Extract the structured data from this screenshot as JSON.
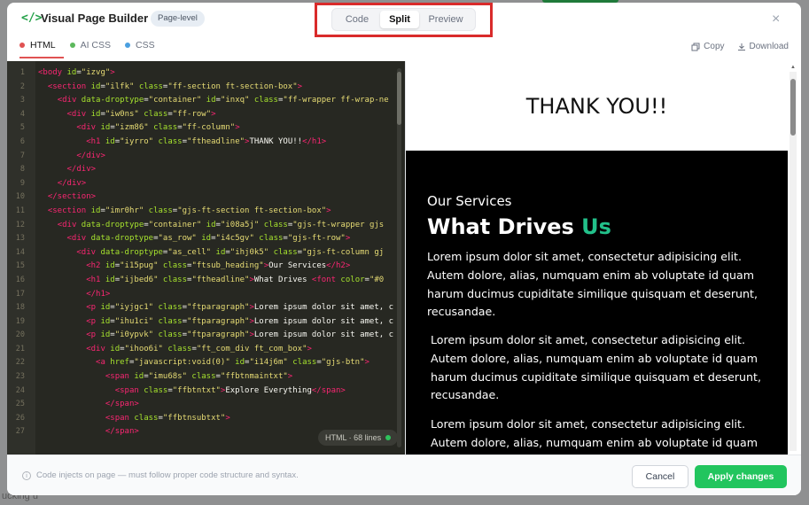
{
  "header": {
    "brand_icon": "</>",
    "title": "Visual Page Builder",
    "badge": "Page-level",
    "view_modes": [
      "Code",
      "Split",
      "Preview"
    ],
    "active_view": "Split",
    "close_icon": "×"
  },
  "file_tabs": [
    {
      "label": "HTML",
      "color": "#e05252",
      "active": true
    },
    {
      "label": "AI CSS",
      "color": "#5cb85c",
      "active": false
    },
    {
      "label": "CSS",
      "color": "#4a9fe0",
      "active": false
    }
  ],
  "actions": {
    "copy": "Copy",
    "download": "Download"
  },
  "editor": {
    "status": "HTML · 68 lines",
    "lines": [
      "<body id=\"izvg\">",
      "  <section id=\"ilfk\" class=\"ff-section ft-section-box\">",
      "    <div data-droptype=\"container\" id=\"inxq\" class=\"ff-wrapper ff-wrap-ne",
      "      <div id=\"iw0ns\" class=\"ff-row\">",
      "        <div id=\"izm86\" class=\"ff-column\">",
      "          <h1 id=\"iyrro\" class=\"ftheadline\">THANK YOU!!</h1>",
      "        </div>",
      "      </div>",
      "    </div>",
      "  </section>",
      "  <section id=\"imr0hr\" class=\"gjs-ft-section ft-section-box\">",
      "    <div data-droptype=\"container\" id=\"i08a5j\" class=\"gjs-ft-wrapper gjs",
      "      <div data-droptype=\"as_row\" id=\"i4c5gv\" class=\"gjs-ft-row\">",
      "        <div data-droptype=\"as_cell\" id=\"ihj0k5\" class=\"gjs-ft-column gj",
      "          <h2 id=\"i15pug\" class=\"ftsub_heading\">Our Services</h2>",
      "          <h1 id=\"ijbed6\" class=\"ftheadline\">What Drives <font color=\"#0",
      "          </h1>",
      "          <p id=\"iyjgc1\" class=\"ftparagraph\">Lorem ipsum dolor sit amet, c",
      "          <p id=\"ihu1ci\" class=\"ftparagraph\">Lorem ipsum dolor sit amet, c",
      "          <p id=\"i0ypvk\" class=\"ftparagraph\">Lorem ipsum dolor sit amet, c",
      "          <div id=\"ihoo6i\" class=\"ft_com_div ft_com_box\">",
      "            <a href=\"javascript:void(0)\" id=\"i14j6m\" class=\"gjs-btn\">",
      "              <span id=\"imu68s\" class=\"ffbtnmaintxt\">",
      "                <span class=\"ffbtntxt\">Explore Everything</span>",
      "              </span>",
      "              <span class=\"ffbtnsubtxt\">",
      "              </span>"
    ]
  },
  "preview": {
    "thanks": "THANK YOU!!",
    "subheading": "Our Services",
    "headline_part1": "What Drives ",
    "headline_part2": "Us",
    "paragraph": "Lorem ipsum dolor sit amet, consectetur adipisicing elit. Autem dolore, alias, numquam enim ab voluptate id quam harum ducimus cupiditate similique quisquam et deserunt, recusandae.",
    "accent_color": "#22c08a"
  },
  "footer": {
    "note": "Code injects on page — must follow proper code structure and syntax.",
    "cancel": "Cancel",
    "apply": "Apply changes"
  },
  "background": {
    "peek_text": "ucking u"
  }
}
